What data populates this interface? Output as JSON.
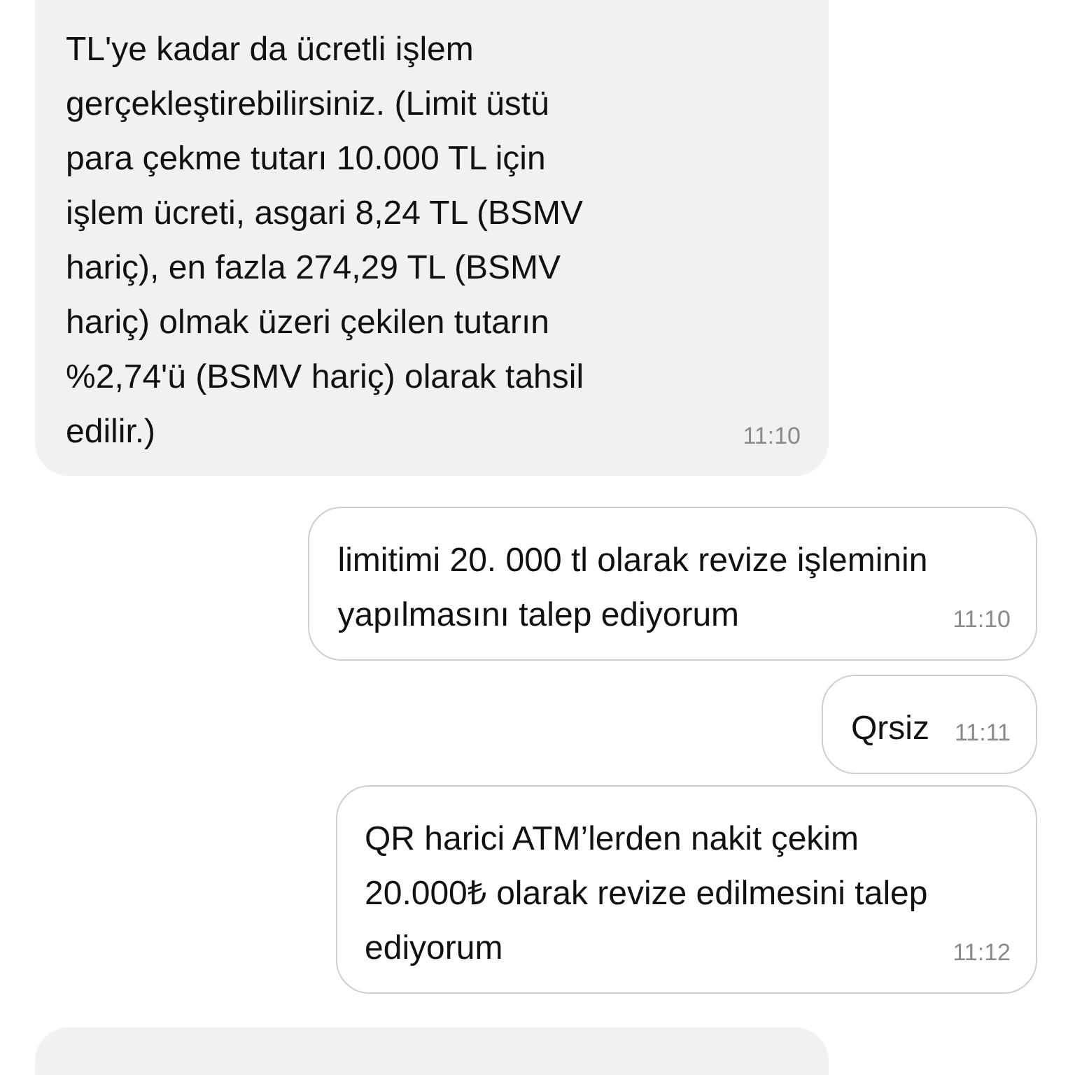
{
  "messages": [
    {
      "kind": "incoming",
      "lines": [
        "TL'ye kadar da ücretli işlem",
        "gerçekleştirebilirsiniz. (Limit üstü",
        "para çekme tutarı 10.000 TL için",
        "işlem ücreti, asgari 8,24 TL (BSMV",
        "hariç), en fazla 274,29 TL (BSMV",
        "hariç) olmak üzeri çekilen tutarın",
        "%2,74'ü (BSMV hariç) olarak tahsil",
        "edilir.)"
      ],
      "time": "11:10"
    },
    {
      "kind": "outgoing",
      "lines": [
        "limitimi 20. 000 tl olarak revize işleminin",
        "yapılmasını talep ediyorum"
      ],
      "time": "11:10"
    },
    {
      "kind": "outgoing",
      "lines": [
        "Qrsiz"
      ],
      "time": "11:11"
    },
    {
      "kind": "outgoing",
      "lines": [
        "QR harici ATM’lerden nakit çekim",
        "20.000₺ olarak revize edilmesini talep",
        "ediyorum"
      ],
      "time": "11:12"
    },
    {
      "kind": "incoming-partial"
    }
  ]
}
